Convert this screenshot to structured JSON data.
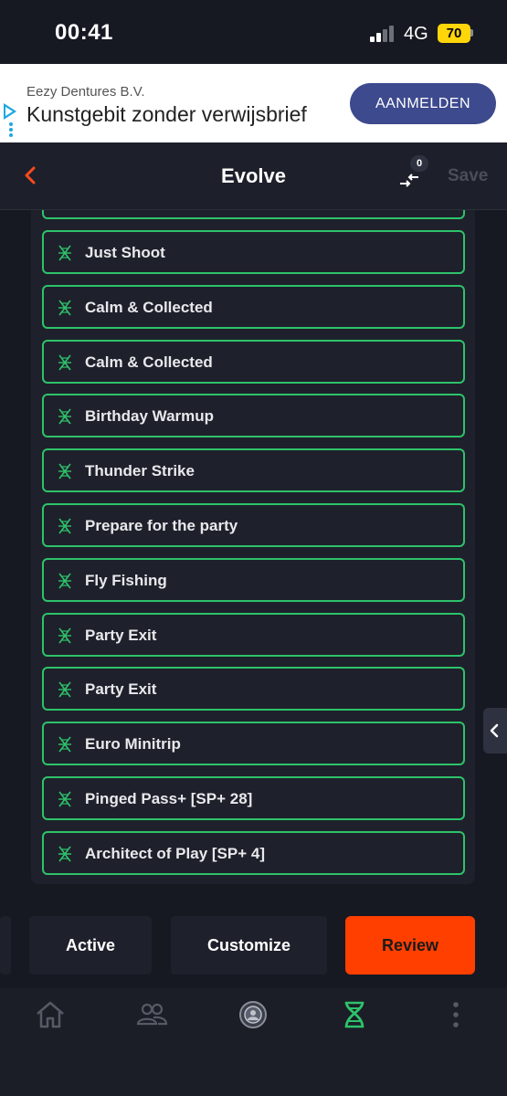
{
  "status_bar": {
    "time": "00:41",
    "network": "4G",
    "battery": "70"
  },
  "ad": {
    "company": "Eezy Dentures B.V.",
    "headline": "Kunstgebit zonder verwijsbrief",
    "cta": "AANMELDEN"
  },
  "header": {
    "title": "Evolve",
    "swap_count": "0",
    "save_label": "Save"
  },
  "items": [
    {
      "label": "Just Shoot"
    },
    {
      "label": "Calm & Collected"
    },
    {
      "label": "Calm & Collected"
    },
    {
      "label": "Birthday Warmup"
    },
    {
      "label": "Thunder Strike"
    },
    {
      "label": "Prepare for the party"
    },
    {
      "label": "Fly Fishing"
    },
    {
      "label": "Party Exit"
    },
    {
      "label": "Party Exit"
    },
    {
      "label": "Euro Minitrip"
    },
    {
      "label": "Pinged Pass+ [SP+ 28]"
    },
    {
      "label": "Architect of Play [SP+ 4]"
    }
  ],
  "actions": {
    "active": "Active",
    "customize": "Customize",
    "review": "Review"
  },
  "nav": [
    "home-icon",
    "friends-icon",
    "club-icon",
    "evolve-dna-icon",
    "more-icon"
  ],
  "colors": {
    "accent_green": "#2ec26a",
    "review_orange": "#ff3f00",
    "ad_cta": "#3d4a8e",
    "battery": "#ffd60a"
  }
}
